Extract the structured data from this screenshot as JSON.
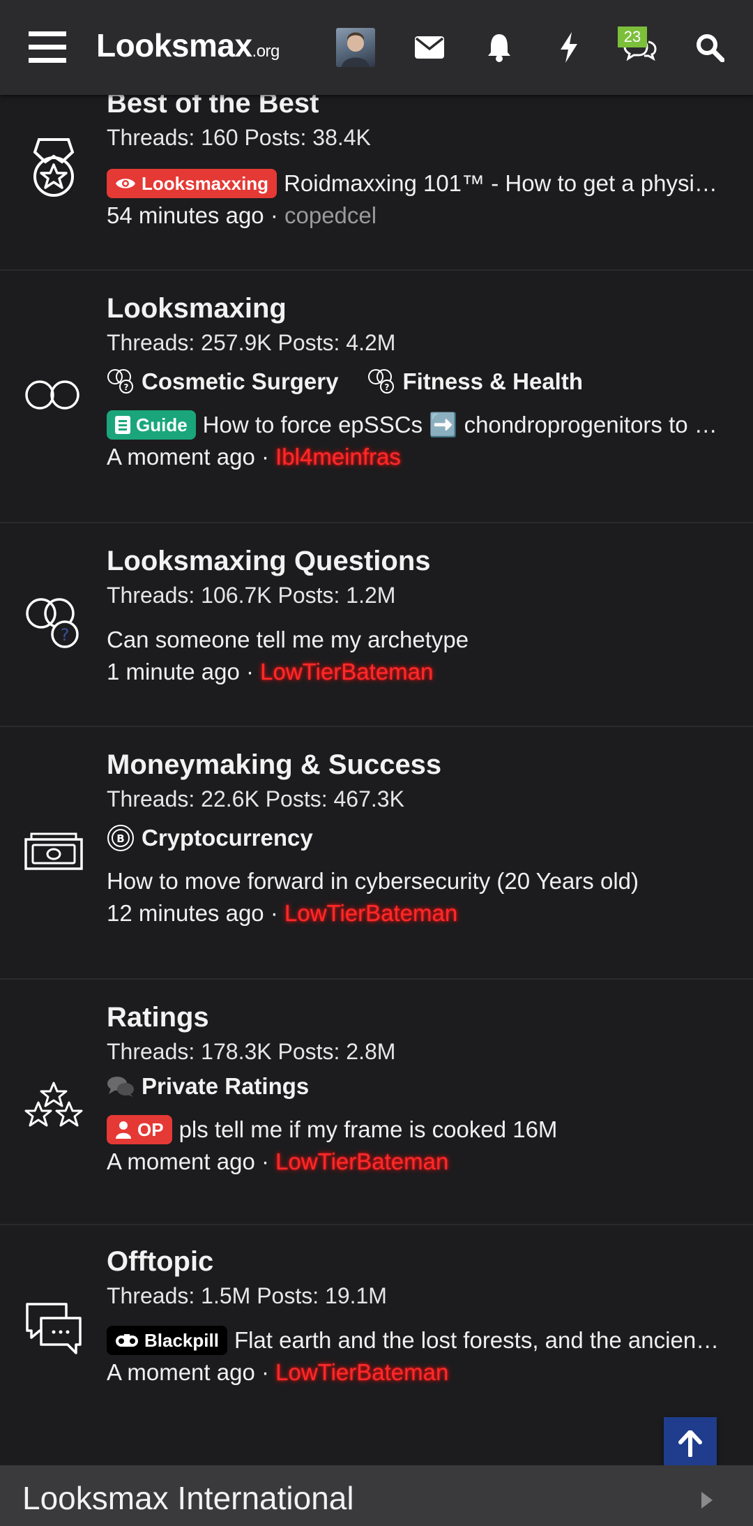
{
  "header": {
    "logo_main": "Looksmax",
    "logo_tld": ".org",
    "conversations_badge": "23",
    "icons": [
      "menu-icon",
      "avatar",
      "envelope-icon",
      "bell-icon",
      "lightning-icon",
      "conversations-icon",
      "search-icon"
    ]
  },
  "forums": [
    {
      "title": "Best of the Best",
      "stats": "Threads: 160 Posts: 38.4K",
      "icon": "medal-icon",
      "subforums": [],
      "latest": {
        "prefix": {
          "label": "Looksmaxxing",
          "icon": "eye-icon",
          "color": "#e53935"
        },
        "title": "Roidmaxxing 101™ - How to get a physi…",
        "time": "54 minutes ago",
        "user": "copedcel",
        "user_style": "gray"
      }
    },
    {
      "title": "Looksmaxing",
      "stats": "Threads: 257.9K Posts: 4.2M",
      "icon": "infinity-rings-icon",
      "subforums": [
        {
          "label": "Cosmetic Surgery",
          "icon": "question-rings-icon"
        },
        {
          "label": "Fitness & Health",
          "icon": "question-rings-icon"
        }
      ],
      "latest": {
        "prefix": {
          "label": "Guide",
          "icon": "book-icon",
          "color": "#1aa67a"
        },
        "title": "How to force epSSCs ➡️ chondroprogenitors to …",
        "time": "A moment ago",
        "user": "Ibl4meinfras",
        "user_style": "red"
      }
    },
    {
      "title": "Looksmaxing Questions",
      "stats": "Threads: 106.7K Posts: 1.2M",
      "icon": "question-rings-icon",
      "subforums": [],
      "latest": {
        "prefix": null,
        "title": "Can someone tell me my archetype",
        "time": "1 minute ago",
        "user": "LowTierBateman",
        "user_style": "red"
      }
    },
    {
      "title": "Moneymaking & Success",
      "stats": "Threads: 22.6K Posts: 467.3K",
      "icon": "money-icon",
      "subforums": [
        {
          "label": "Cryptocurrency",
          "icon": "bitcoin-icon"
        }
      ],
      "latest": {
        "prefix": null,
        "title": "How to move forward in cybersecurity (20 Years old)",
        "time": "12 minutes ago",
        "user": "LowTierBateman",
        "user_style": "red"
      }
    },
    {
      "title": "Ratings",
      "stats": "Threads: 178.3K Posts: 2.8M",
      "icon": "stars-icon",
      "subforums": [
        {
          "label": "Private Ratings",
          "icon": "chat-bubbles-icon"
        }
      ],
      "latest": {
        "prefix": {
          "label": "OP",
          "icon": "user-icon",
          "color": "#e53935"
        },
        "title": "pls tell me if my frame is cooked 16M",
        "time": "A moment ago",
        "user": "LowTierBateman",
        "user_style": "red"
      }
    },
    {
      "title": "Offtopic",
      "stats": "Threads: 1.5M Posts: 19.1M",
      "icon": "chat-icon",
      "subforums": [],
      "latest": {
        "prefix": {
          "label": "Blackpill",
          "icon": "pill-icon",
          "color": "#000000"
        },
        "title": "Flat earth and the lost forests, and the ancien…",
        "time": "A moment ago",
        "user": "LowTierBateman",
        "user_style": "red"
      }
    }
  ],
  "category": {
    "title": "Looksmax International"
  },
  "colors": {
    "background": "#1c1c1e",
    "topbar": "#2b2b2d",
    "username_red": "#ff2a2a",
    "badge_green": "#7cbf3a",
    "scroll_top": "#1f3d8c"
  }
}
